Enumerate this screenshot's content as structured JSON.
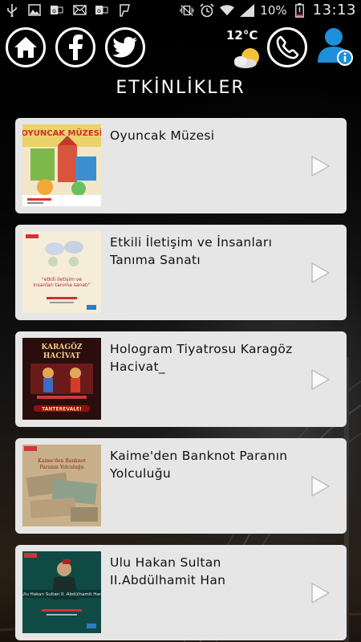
{
  "status_bar": {
    "battery_percent": "10%",
    "time": "13:13",
    "icons": [
      "usb-icon",
      "image-icon",
      "outlook-icon",
      "email-icon",
      "outlook-icon",
      "foursquare-icon",
      "vibrate-icon",
      "alarm-icon",
      "wifi-icon",
      "signal-icon",
      "battery-icon"
    ]
  },
  "header": {
    "buttons": [
      "home-icon",
      "facebook-icon",
      "twitter-icon"
    ],
    "temperature": "12°C",
    "weather_icon": "partly-cloudy-icon",
    "call_icon": "phone-icon",
    "info_icon": "user-info-icon"
  },
  "page": {
    "title": "ETKİNLİKLER"
  },
  "events": [
    {
      "title": "Oyuncak Müzesi",
      "thumb_text": "OYUNCAK MÜZESİ"
    },
    {
      "title": "Etkili İletişim ve İnsanları Tanıma Sanatı",
      "thumb_text": "\"etkili iletişim ve insanları tanıma sanatı\""
    },
    {
      "title": "Hologram Tiyatrosu Karagöz Hacivat_",
      "thumb_text": "KARAGÖZ HACİVAT"
    },
    {
      "title": "Kaime'den Banknot Paranın Yolculuğu",
      "thumb_text": "Kaime'den Banknot Paranın Yolculuğu"
    },
    {
      "title": "Ulu Hakan Sultan II.Abdülhamit Han",
      "thumb_text": "Ulu Hakan Sultan II. Abdülhamit Han"
    }
  ],
  "colors": {
    "card_bg": "#e6e6e6",
    "title_text": "#ffffff",
    "profile_blue": "#1e8fd8"
  }
}
